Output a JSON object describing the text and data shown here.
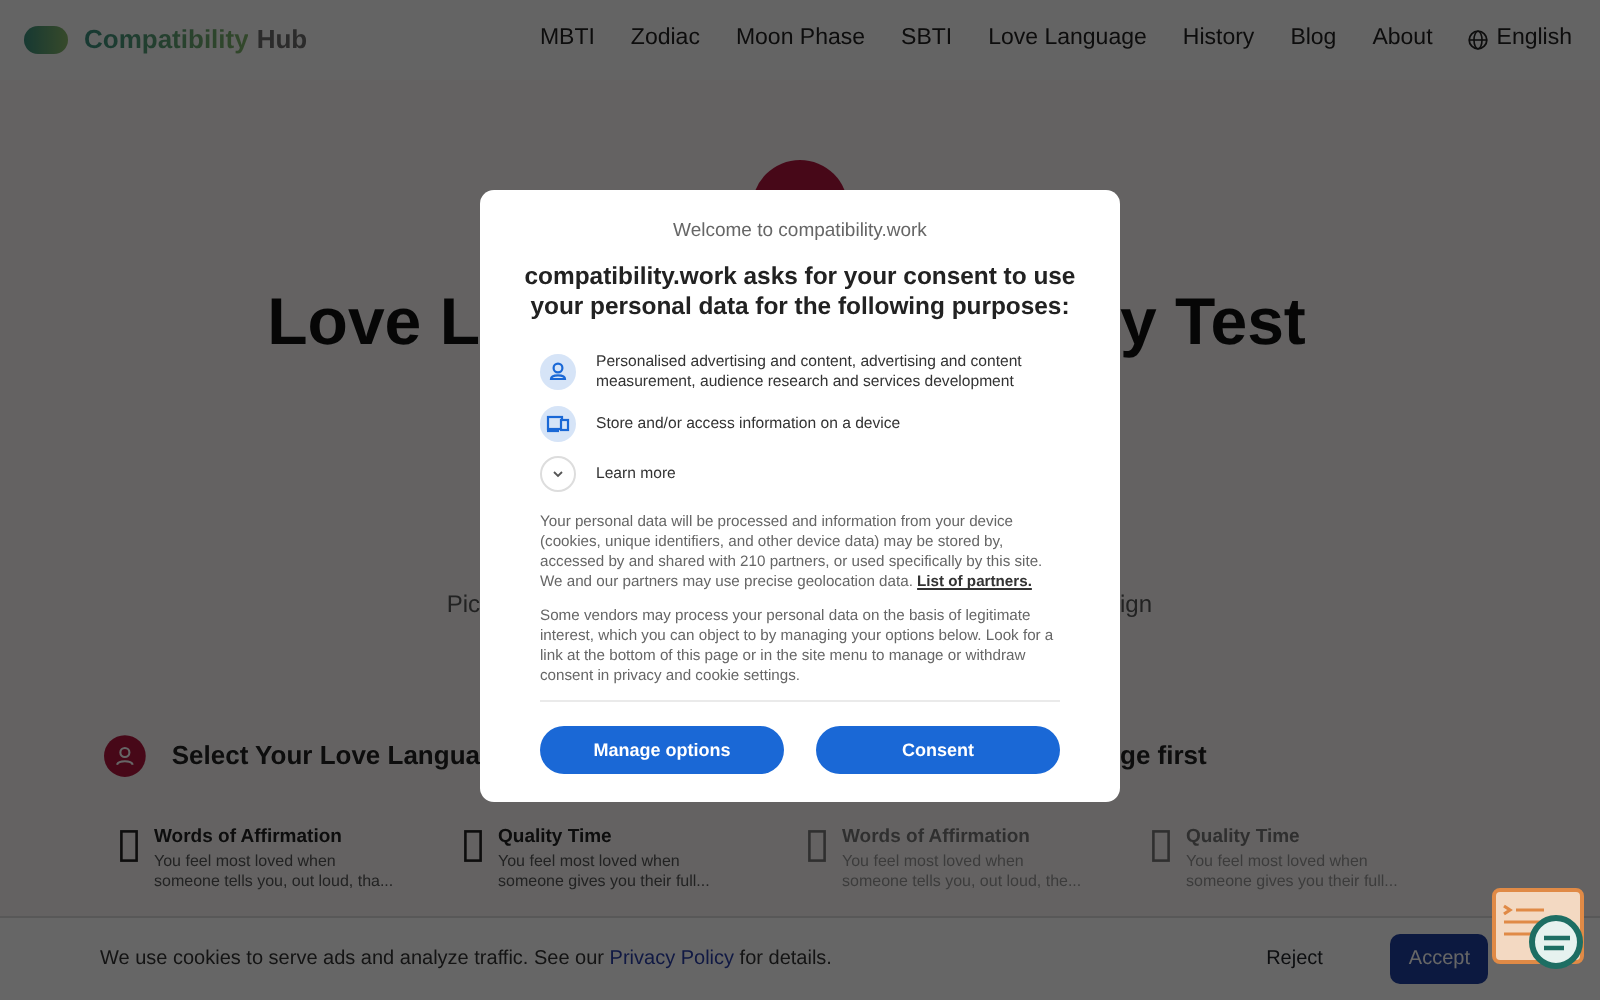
{
  "navbar": {
    "brand": {
      "primary": "Compatibility",
      "secondary": "Hub"
    },
    "links": [
      "MBTI",
      "Zodiac",
      "Moon Phase",
      "SBTI",
      "Love Language",
      "History",
      "Blog",
      "About"
    ],
    "language": "English"
  },
  "hero": {
    "title_left": "Love L",
    "title_right": "y Test",
    "subtitle_left": "Pic",
    "subtitle_right": "ign"
  },
  "section": {
    "heading_left": "Select Your Love Langua",
    "heading_right": "ge first"
  },
  "cards": [
    {
      "title": "Words of Affirmation",
      "description": "You feel most loved when someone tells you, out loud, tha...",
      "dimmed": false
    },
    {
      "title": "Quality Time",
      "description": "You feel most loved when someone gives you their full...",
      "dimmed": false
    },
    {
      "title": "Words of Affirmation",
      "description": "You feel most loved when someone tells you, out loud, the...",
      "dimmed": true
    },
    {
      "title": "Quality Time",
      "description": "You feel most loved when someone gives you their full...",
      "dimmed": true
    }
  ],
  "cookie_bar": {
    "text_before": "We use cookies to serve ads and analyze traffic. See our ",
    "link": "Privacy Policy",
    "text_after": " for details.",
    "buttons": [
      {
        "label": "Reject",
        "kind": "plain"
      },
      {
        "label": "Accept",
        "kind": "primary"
      }
    ]
  },
  "consent_dialog": {
    "welcome": "Welcome to compatibility.work",
    "heading": "compatibility.work asks for your consent to use your personal data for the following purposes:",
    "purposes": [
      {
        "kind": "person",
        "text": "Personalised advertising and content, advertising and content measurement, audience research and services development"
      },
      {
        "kind": "device",
        "text": "Store and/or access information on a device"
      }
    ],
    "learn_more": "Learn more",
    "paragraph_1": "Your personal data will be processed and information from your device (cookies, unique identifiers, and other device data) may be stored by, accessed by and shared with 210 partners, or used specifically by this site. We and our partners may use precise geolocation data.",
    "partners_link": "List of partners.",
    "paragraph_2": "Some vendors may process your personal data on the basis of legitimate interest, which you can object to by managing your options below. Look for a link at the bottom of this page or in the site menu to manage or withdraw consent in privacy and cookie settings.",
    "buttons": [
      "Manage options",
      "Consent"
    ]
  }
}
